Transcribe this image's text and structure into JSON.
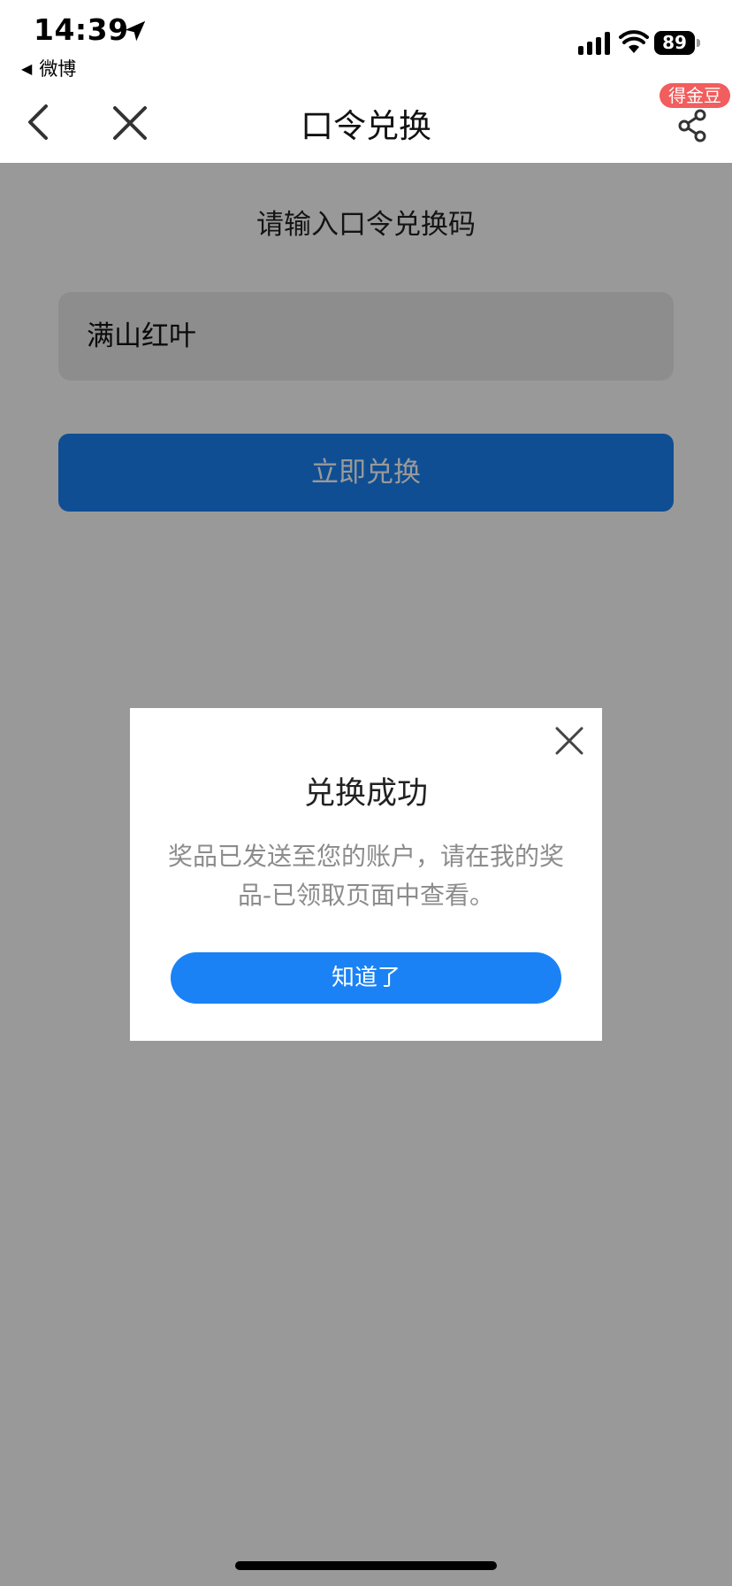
{
  "status_bar": {
    "time": "14:39",
    "back_app": "微博",
    "battery": "89"
  },
  "nav": {
    "title": "口令兑换",
    "badge": "得金豆"
  },
  "main": {
    "prompt": "请输入口令兑换码",
    "input_value": "满山红叶",
    "redeem_button": "立即兑换"
  },
  "modal": {
    "title": "兑换成功",
    "message": "奖品已发送至您的账户，请在我的奖品-已领取页面中查看。",
    "ok_button": "知道了"
  },
  "colors": {
    "accent": "#1a82f5",
    "badge": "#f25d5d"
  }
}
